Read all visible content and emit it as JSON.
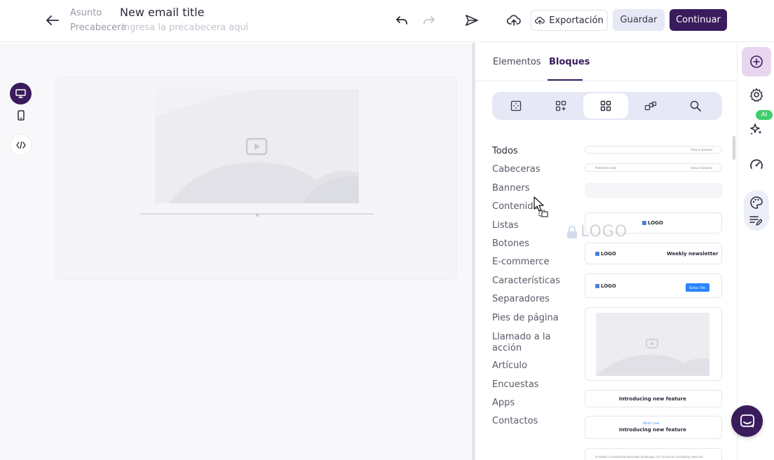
{
  "header": {
    "subject_label": "Asunto",
    "subject_value": "New email title",
    "preheader_label": "Precabecera",
    "preheader_placeholder": "Ingresa la precabecera aquí",
    "export_label": "Exportación",
    "save_label": "Guardar",
    "continue_label": "Continuar"
  },
  "panel": {
    "tabs": [
      {
        "label": "Elementos",
        "active": false
      },
      {
        "label": "Bloques",
        "active": true
      }
    ],
    "categories": [
      "Todos",
      "Cabeceras",
      "Banners",
      "Contenido",
      "Listas",
      "Botones",
      "E-commerce",
      "Características",
      "Separadores",
      "Pies de página",
      "Llamado a la acción",
      "Artículo",
      "Encuestas",
      "Apps",
      "Contactos"
    ],
    "active_category": "Todos",
    "thumbnails": {
      "header_link_1": "View in browser",
      "header_left_2": "Preheader text",
      "header_link_2": "View in browser",
      "logo": "LOGO",
      "newsletter": "Weekly newsletter",
      "button_title": "Button Title",
      "feature_title": "Introducing new feature",
      "whats_new": "What's new",
      "feature_title_2": "Introducing new feature",
      "paragraph": "In today's competitive business landscape, it's crucial to constantly seek out"
    }
  },
  "drag_ghost": {
    "label": "LOGO"
  },
  "rail": {
    "ai_badge": "AI"
  },
  "colors": {
    "brand": "#3a1c5c",
    "accent_soft": "#e8d6ef",
    "segment_bg": "#e6e8f6",
    "ai_green": "#3ecf6a",
    "link_blue": "#2a86ff"
  }
}
